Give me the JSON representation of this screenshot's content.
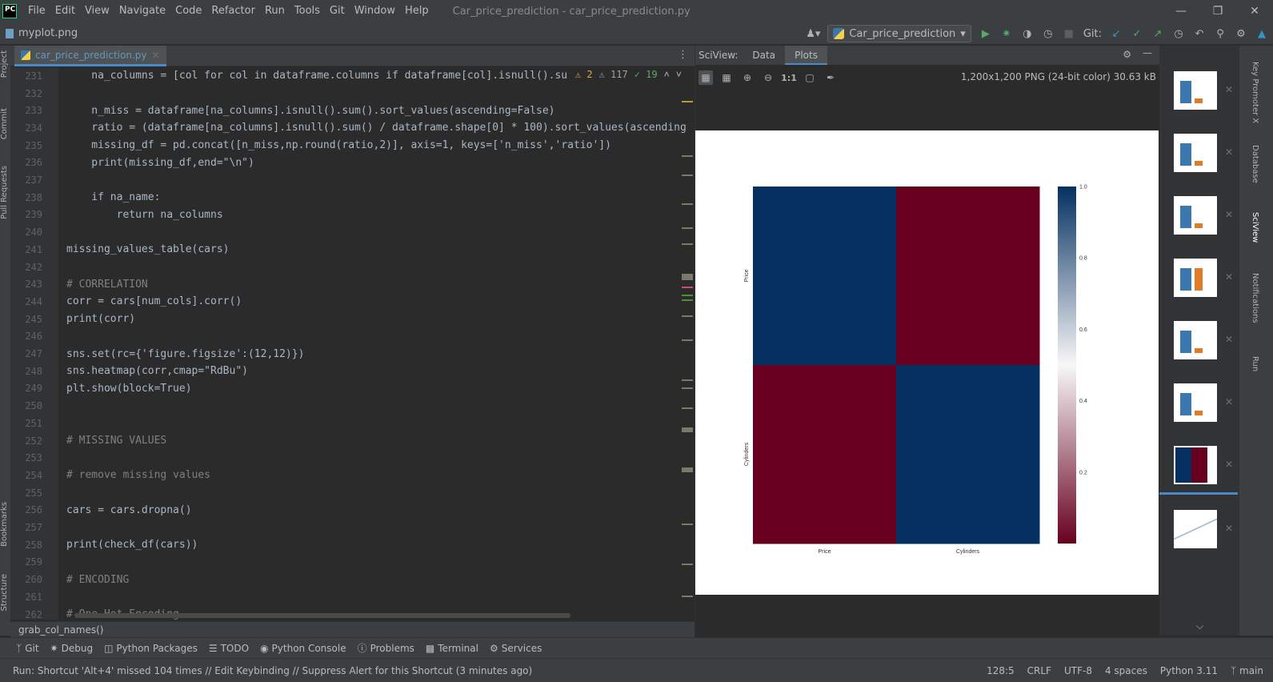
{
  "app": {
    "logo_text": "PC",
    "window_title": "Car_price_prediction - car_price_prediction.py"
  },
  "menu": [
    "File",
    "Edit",
    "View",
    "Navigate",
    "Code",
    "Refactor",
    "Run",
    "Tools",
    "Git",
    "Window",
    "Help"
  ],
  "nav": {
    "file": "myplot.png",
    "run_config": "Car_price_prediction",
    "git_label": "Git:"
  },
  "left_strip": [
    "Project",
    "Commit",
    "Pull Requests",
    "Bookmarks",
    "Structure"
  ],
  "editor": {
    "tab": "car_price_prediction.py",
    "inspections": {
      "warnings": "2",
      "weak_warnings": "117",
      "ok": "19"
    },
    "lines": [
      {
        "n": "231",
        "code": "    na_columns = [col for col in dataframe.columns if dataframe[col].isnull().su"
      },
      {
        "n": "232",
        "code": ""
      },
      {
        "n": "233",
        "code": "    n_miss = dataframe[na_columns].isnull().sum().sort_values(ascending=False)"
      },
      {
        "n": "234",
        "code": "    ratio = (dataframe[na_columns].isnull().sum() / dataframe.shape[0] * 100).sort_values(ascending"
      },
      {
        "n": "235",
        "code": "    missing_df = pd.concat([n_miss,np.round(ratio,2)], axis=1, keys=['n_miss','ratio'])"
      },
      {
        "n": "236",
        "code": "    print(missing_df,end=\"\\n\")"
      },
      {
        "n": "237",
        "code": ""
      },
      {
        "n": "238",
        "code": "    if na_name:"
      },
      {
        "n": "239",
        "code": "        return na_columns"
      },
      {
        "n": "240",
        "code": ""
      },
      {
        "n": "241",
        "code": "missing_values_table(cars)"
      },
      {
        "n": "242",
        "code": ""
      },
      {
        "n": "243",
        "code": "# CORRELATION"
      },
      {
        "n": "244",
        "code": "corr = cars[num_cols].corr()"
      },
      {
        "n": "245",
        "code": "print(corr)"
      },
      {
        "n": "246",
        "code": ""
      },
      {
        "n": "247",
        "code": "sns.set(rc={'figure.figsize':(12,12)})"
      },
      {
        "n": "248",
        "code": "sns.heatmap(corr,cmap=\"RdBu\")"
      },
      {
        "n": "249",
        "code": "plt.show(block=True)"
      },
      {
        "n": "250",
        "code": ""
      },
      {
        "n": "251",
        "code": ""
      },
      {
        "n": "252",
        "code": "# MISSING VALUES"
      },
      {
        "n": "253",
        "code": ""
      },
      {
        "n": "254",
        "code": "# remove missing values"
      },
      {
        "n": "255",
        "code": ""
      },
      {
        "n": "256",
        "code": "cars = cars.dropna()"
      },
      {
        "n": "257",
        "code": ""
      },
      {
        "n": "258",
        "code": "print(check_df(cars))"
      },
      {
        "n": "259",
        "code": ""
      },
      {
        "n": "260",
        "code": "# ENCODING"
      },
      {
        "n": "261",
        "code": ""
      },
      {
        "n": "262",
        "code": "# One Hot Encoding"
      }
    ],
    "breadcrumb": "grab_col_names()"
  },
  "sciview": {
    "title": "SciView:",
    "tabs": [
      "Data",
      "Plots"
    ],
    "active_tab": "Plots",
    "zoom_label": "1:1",
    "image_info": "1,200x1,200 PNG (24-bit color) 30.63 kB"
  },
  "chart_data": {
    "type": "heatmap",
    "rows": [
      "Price",
      "Cylinders"
    ],
    "cols": [
      "Price",
      "Cylinders"
    ],
    "values": [
      [
        1.0,
        0.0
      ],
      [
        0.0,
        1.0
      ]
    ],
    "colormap": "RdBu",
    "colorbar_ticks": [
      "1.0",
      "0.8",
      "0.6",
      "0.4",
      "0.2"
    ],
    "colorbar_range": [
      0.0,
      1.0
    ],
    "colors": {
      "high": "#053061",
      "low": "#67001f"
    }
  },
  "thumbnails_count": 8,
  "right_strip": [
    "Key Promoter X",
    "Database",
    "SciView",
    "Notifications",
    "Run"
  ],
  "toolwindows": [
    "Git",
    "Debug",
    "Python Packages",
    "TODO",
    "Python Console",
    "Problems",
    "Terminal",
    "Services"
  ],
  "status": {
    "message": "Run: Shortcut 'Alt+4' missed 104 times // Edit Keybinding // Suppress Alert for this Shortcut (3 minutes ago)",
    "position": "128:5",
    "line_sep": "CRLF",
    "encoding": "UTF-8",
    "indent": "4 spaces",
    "interpreter": "Python 3.11",
    "branch": "main"
  }
}
